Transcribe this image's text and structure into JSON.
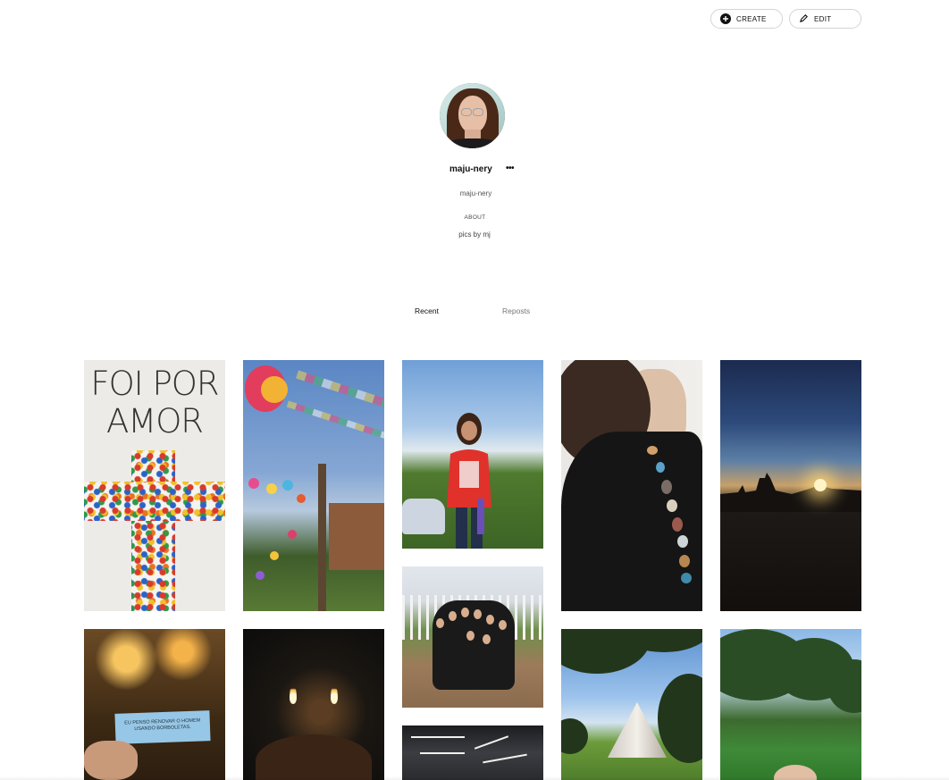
{
  "header": {
    "create_label": "CREATE",
    "edit_label": "EDIT"
  },
  "profile": {
    "display_name": "maju-nery",
    "more_label": "•••",
    "handle": "maju-nery",
    "about_label": "ABOUT",
    "about_text": "pics by mj"
  },
  "tabs": [
    {
      "label": "Recent",
      "active": true
    },
    {
      "label": "Reposts",
      "active": false
    }
  ],
  "posts": {
    "p1_text": "FOI POR\nAMOR",
    "p6_text": "EU PENSO RENOVAR O HOMEM USANDO BORBOLETAS."
  },
  "colors": {
    "accent": "#111111",
    "border": "#d4d4d4",
    "muted_text": "#777777"
  }
}
